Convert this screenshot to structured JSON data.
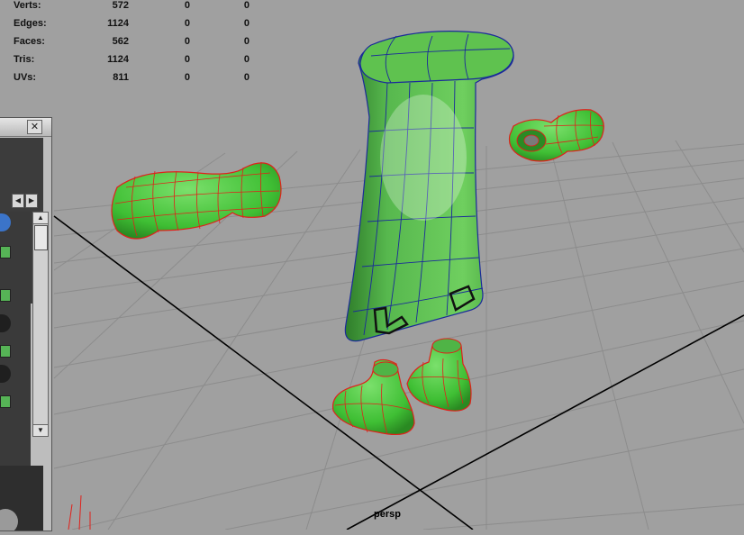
{
  "hud": {
    "rows": [
      {
        "label": "Verts:",
        "v1": "572",
        "v2": "0",
        "v3": "0"
      },
      {
        "label": "Edges:",
        "v1": "1124",
        "v2": "0",
        "v3": "0"
      },
      {
        "label": "Faces:",
        "v1": "562",
        "v2": "0",
        "v3": "0"
      },
      {
        "label": "Tris:",
        "v1": "1124",
        "v2": "0",
        "v3": "0"
      },
      {
        "label": "UVs:",
        "v1": "811",
        "v2": "0",
        "v3": "0"
      }
    ]
  },
  "viewport": {
    "camera_label": "persp"
  },
  "panel": {
    "close_glyph": "✕",
    "tab_left_glyph": "◀",
    "tab_right_glyph": "▶",
    "scroll_up_glyph": "▲",
    "scroll_down_glyph": "▼"
  },
  "colors": {
    "viewport_bg": "#a0a0a0",
    "mesh_green": "#4fc04a",
    "wire_red": "#e0201a",
    "wire_blue": "#1a2a9a",
    "grid": "#8a8a8a",
    "axis": "#000000"
  }
}
